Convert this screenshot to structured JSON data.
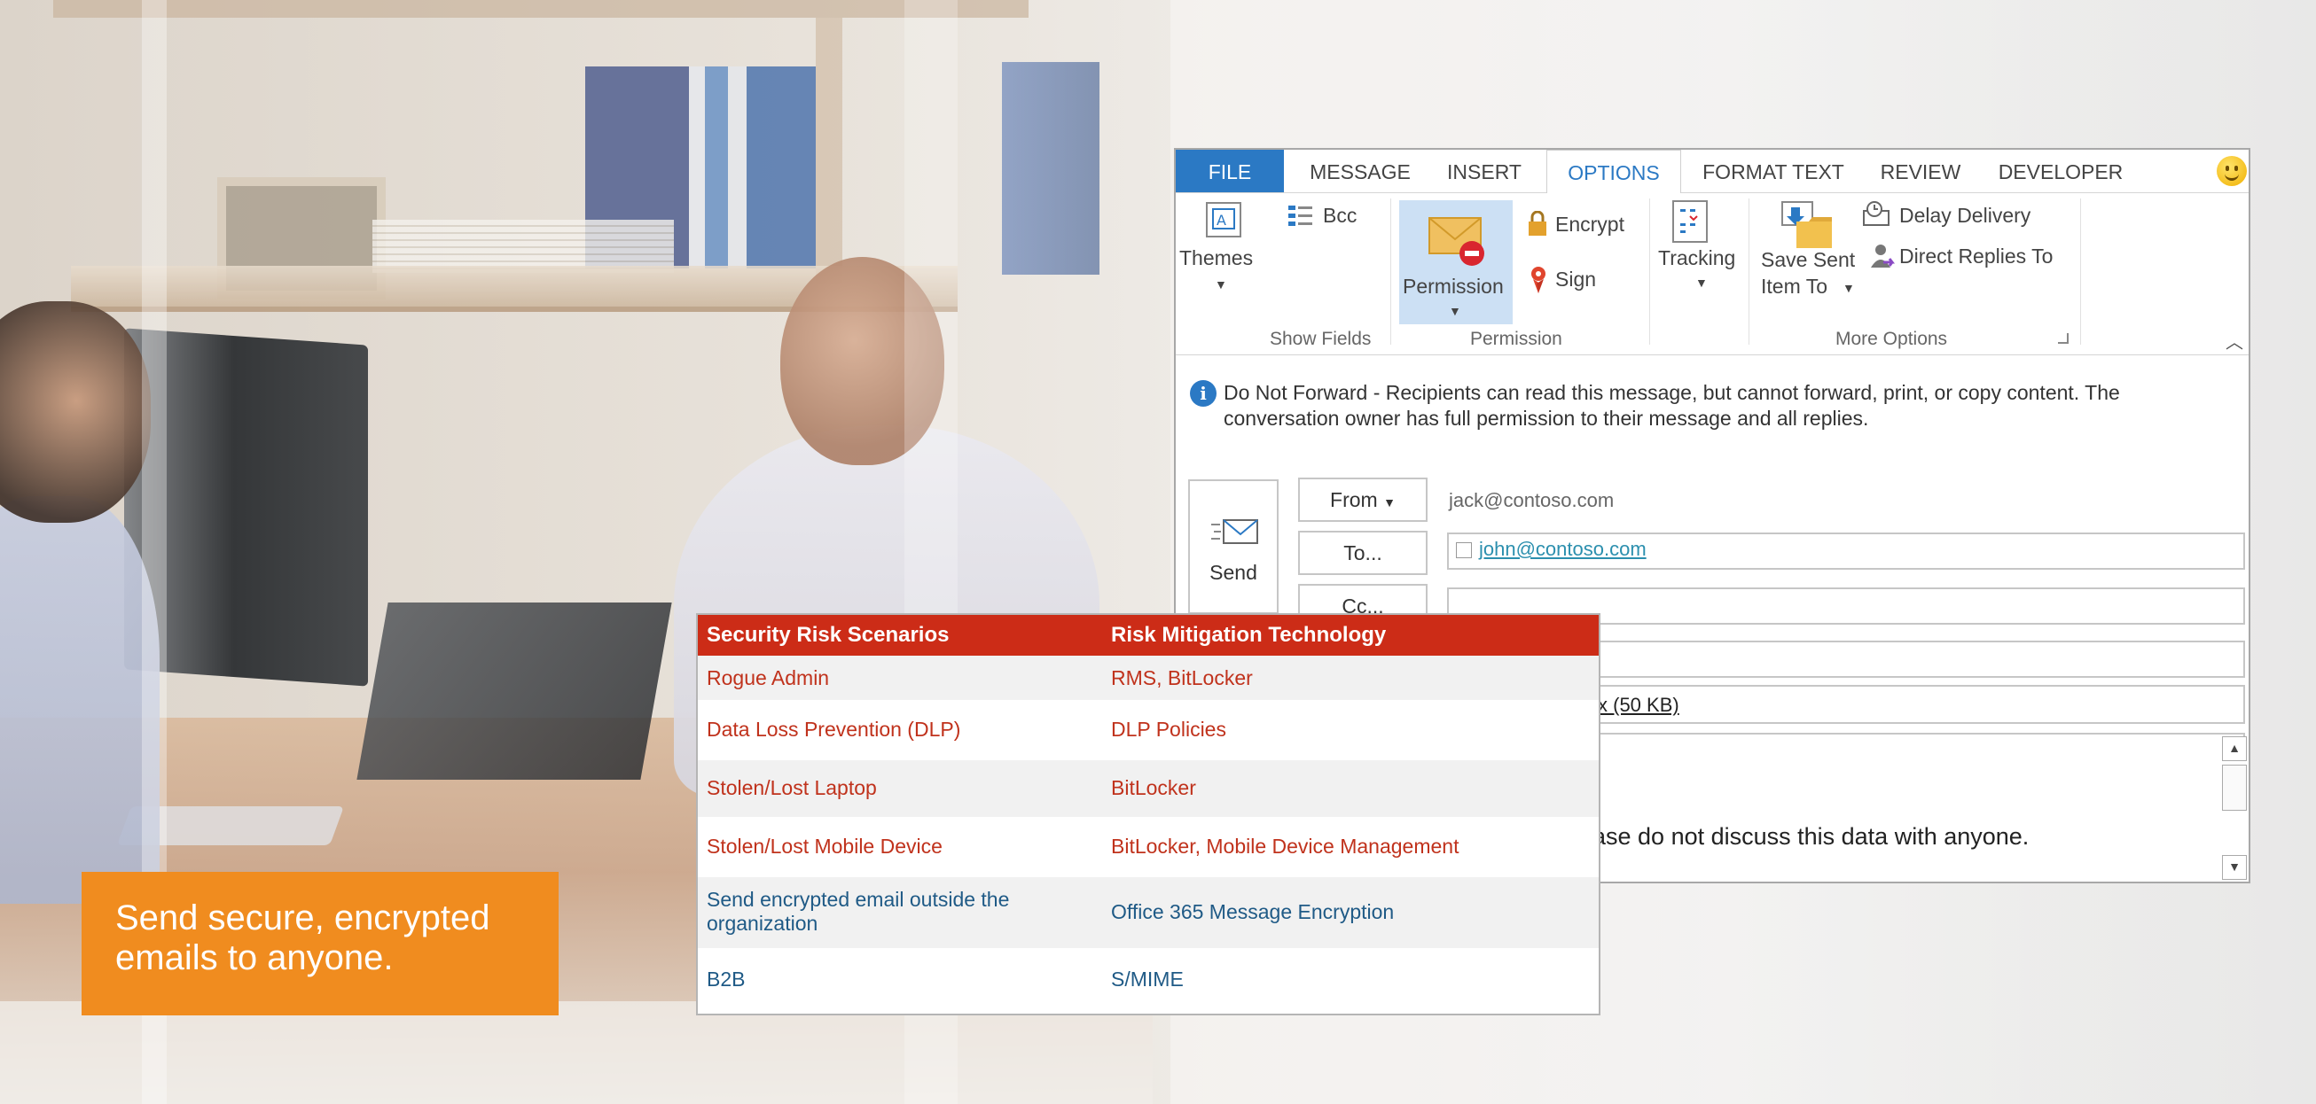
{
  "outlook": {
    "tabs": [
      "FILE",
      "MESSAGE",
      "INSERT",
      "OPTIONS",
      "FORMAT TEXT",
      "REVIEW",
      "DEVELOPER"
    ],
    "ribbon": {
      "themes_label": "Themes",
      "bcc_label": "Bcc",
      "show_fields_group": "Show Fields",
      "permission_label": "Permission",
      "encrypt_label": "Encrypt",
      "sign_label": "Sign",
      "permission_group": "Permission",
      "tracking_label": "Tracking",
      "save_sent_line1": "Save Sent",
      "save_sent_line2": "Item To",
      "delay_delivery_label": "Delay Delivery",
      "direct_replies_label": "Direct Replies To",
      "more_options_group": "More Options"
    },
    "info_message": "Do Not Forward - Recipients can read this message, but cannot forward, print, or copy content. The conversation owner has full permission to their message and all replies.",
    "send_label": "Send",
    "from_label": "From",
    "from_value": "jack@contoso.com",
    "to_label": "To...",
    "to_value": "john@contoso.com",
    "cc_label": "Cc...",
    "attachment_text": "x (50 KB)",
    "body_text": "ase do not discuss this data with anyone."
  },
  "risk_table": {
    "headers": [
      "Security Risk Scenarios",
      "Risk Mitigation Technology"
    ],
    "rows": [
      {
        "scenario": "Rogue Admin",
        "technology": "RMS, BitLocker"
      },
      {
        "scenario": "Data Loss Prevention (DLP)",
        "technology": "DLP Policies"
      },
      {
        "scenario": "Stolen/Lost Laptop",
        "technology": "BitLocker"
      },
      {
        "scenario": "Stolen/Lost Mobile Device",
        "technology": "BitLocker, Mobile Device Management"
      },
      {
        "scenario": "Send encrypted email outside the organization",
        "technology": "Office 365 Message Encryption"
      },
      {
        "scenario": "B2B",
        "technology": "S/MIME"
      }
    ]
  },
  "callout": {
    "text": "Send secure, encrypted emails to anyone."
  },
  "colors": {
    "accent_blue": "#2b79c4",
    "table_header_red": "#cc2c17",
    "callout_orange": "#f08c1f",
    "red_text": "#c0321c",
    "blue_text": "#1f5a86"
  }
}
